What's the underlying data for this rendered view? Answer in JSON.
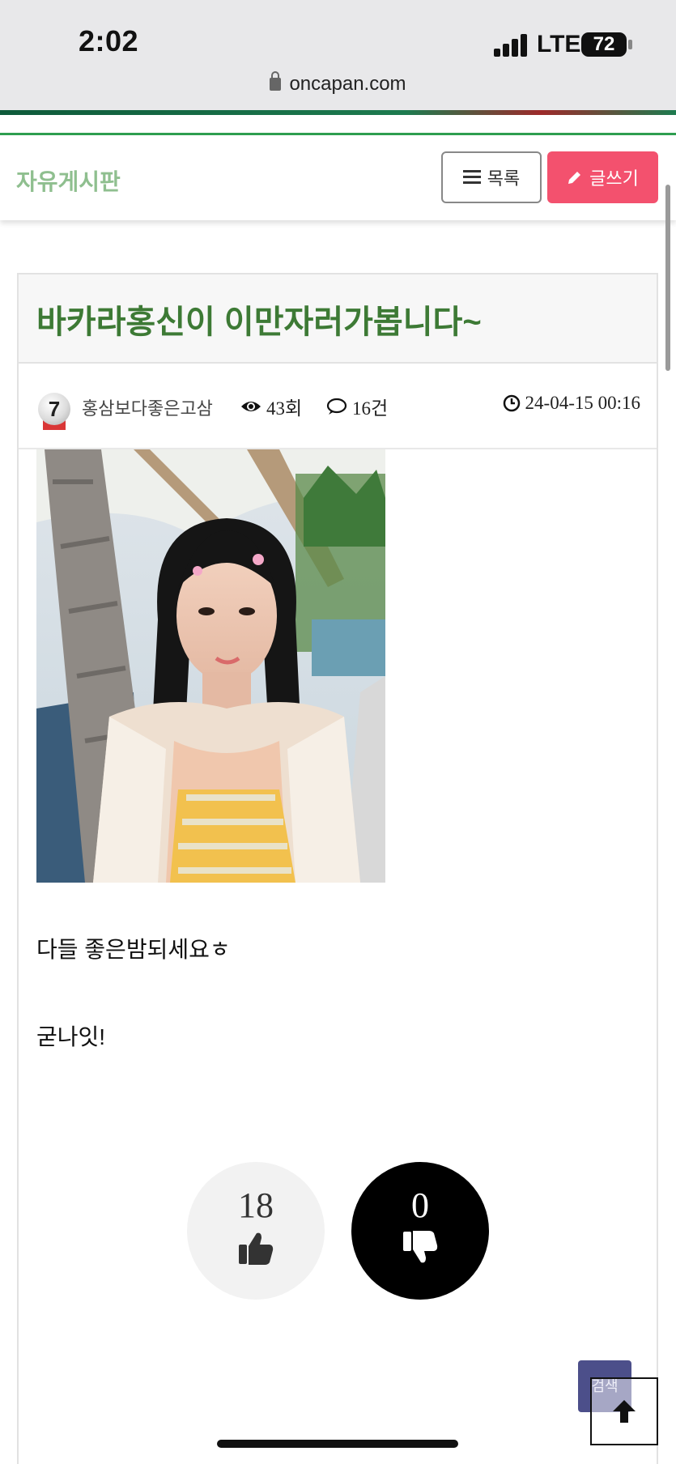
{
  "status_bar": {
    "time": "2:02",
    "network": "LTE",
    "battery": "72"
  },
  "browser": {
    "url": "oncapan.com"
  },
  "board": {
    "title": "자유게시판",
    "list_label": "목록",
    "write_label": "글쓰기"
  },
  "post": {
    "title": "바카라홍신이 이만자러가봅니다~",
    "level": "7",
    "author": "홍삼보다좋은고삼",
    "views": "43회",
    "comments": "16건",
    "date": "24-04-15 00:16",
    "body": [
      "다들 좋은밤되세요ㅎ",
      "굳나잇!"
    ]
  },
  "votes": {
    "up": "18",
    "down": "0"
  },
  "floating": {
    "search_label": "검색"
  },
  "colors": {
    "accent_green": "#3d7a35",
    "write_button": "#f3516e",
    "board_title": "#8fbf8f"
  }
}
